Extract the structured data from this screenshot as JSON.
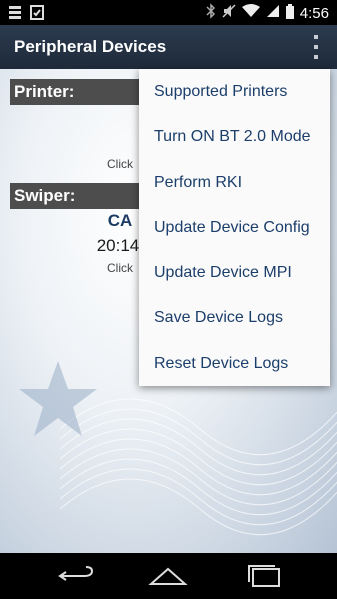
{
  "status_bar": {
    "time": "4:56",
    "icons": [
      "storage-icon",
      "clipboard-check-icon",
      "bluetooth-icon",
      "mute-icon",
      "wifi-icon",
      "signal-icon",
      "battery-icon"
    ]
  },
  "action_bar": {
    "title": "Peripheral Devices"
  },
  "printer": {
    "header": "Printer:",
    "click_hint": "Click"
  },
  "swiper": {
    "header": "Swiper:",
    "status": "CA",
    "time": "20:14",
    "click_hint": "Click"
  },
  "menu": {
    "items": [
      {
        "label": "Supported Printers"
      },
      {
        "label": "Turn ON BT 2.0 Mode"
      },
      {
        "label": "Perform RKI"
      },
      {
        "label": "Update Device Config"
      },
      {
        "label": "Update Device MPI"
      },
      {
        "label": "Save Device Logs"
      },
      {
        "label": "Reset Device Logs"
      }
    ]
  },
  "nav_bar": {
    "icons": [
      "back-icon",
      "home-icon",
      "recent-apps-icon"
    ]
  }
}
